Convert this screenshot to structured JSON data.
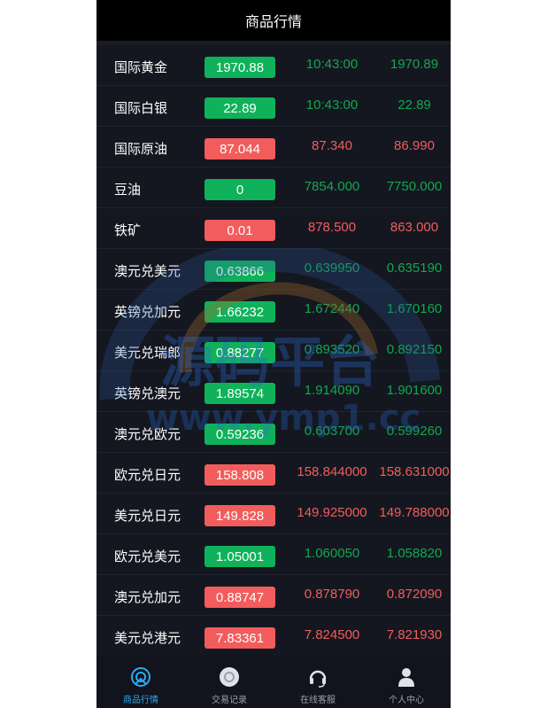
{
  "header": {
    "title": "商品行情"
  },
  "rows": [
    {
      "name": "国际黄金",
      "price": "1970.88",
      "col1": "10:43:00",
      "col2": "1970.89",
      "trend": "up"
    },
    {
      "name": "国际白银",
      "price": "22.89",
      "col1": "10:43:00",
      "col2": "22.89",
      "trend": "up"
    },
    {
      "name": "国际原油",
      "price": "87.044",
      "col1": "87.340",
      "col2": "86.990",
      "trend": "down"
    },
    {
      "name": "豆油",
      "price": "0",
      "col1": "7854.000",
      "col2": "7750.000",
      "trend": "up"
    },
    {
      "name": "铁矿",
      "price": "0.01",
      "col1": "878.500",
      "col2": "863.000",
      "trend": "down"
    },
    {
      "name": "澳元兑美元",
      "price": "0.63866",
      "col1": "0.639950",
      "col2": "0.635190",
      "trend": "up"
    },
    {
      "name": "英镑兑加元",
      "price": "1.66232",
      "col1": "1.672440",
      "col2": "1.670160",
      "trend": "up"
    },
    {
      "name": "美元兑瑞郎",
      "price": "0.88277",
      "col1": "0.893520",
      "col2": "0.892150",
      "trend": "up"
    },
    {
      "name": "英镑兑澳元",
      "price": "1.89574",
      "col1": "1.914090",
      "col2": "1.901600",
      "trend": "up"
    },
    {
      "name": "澳元兑欧元",
      "price": "0.59236",
      "col1": "0.603700",
      "col2": "0.599260",
      "trend": "up"
    },
    {
      "name": "欧元兑日元",
      "price": "158.808",
      "col1": "158.844000",
      "col2": "158.631000",
      "trend": "down"
    },
    {
      "name": "美元兑日元",
      "price": "149.828",
      "col1": "149.925000",
      "col2": "149.788000",
      "trend": "down"
    },
    {
      "name": "欧元兑美元",
      "price": "1.05001",
      "col1": "1.060050",
      "col2": "1.058820",
      "trend": "up"
    },
    {
      "name": "澳元兑加元",
      "price": "0.88747",
      "col1": "0.878790",
      "col2": "0.872090",
      "trend": "down"
    },
    {
      "name": "美元兑港元",
      "price": "7.83361",
      "col1": "7.824500",
      "col2": "7.821930",
      "trend": "down"
    }
  ],
  "watermark": {
    "text": "源码平台",
    "url": "www.ymp1.cc"
  },
  "tabs": [
    {
      "label": "商品行情",
      "icon": "market-icon",
      "active": true
    },
    {
      "label": "交易记录",
      "icon": "records-icon",
      "active": false
    },
    {
      "label": "在线客服",
      "icon": "headset-icon",
      "active": false
    },
    {
      "label": "个人中心",
      "icon": "user-icon",
      "active": false
    }
  ],
  "colors": {
    "up": "#0fb25a",
    "down": "#f25c5c",
    "active_tab": "#2ea8f0"
  }
}
